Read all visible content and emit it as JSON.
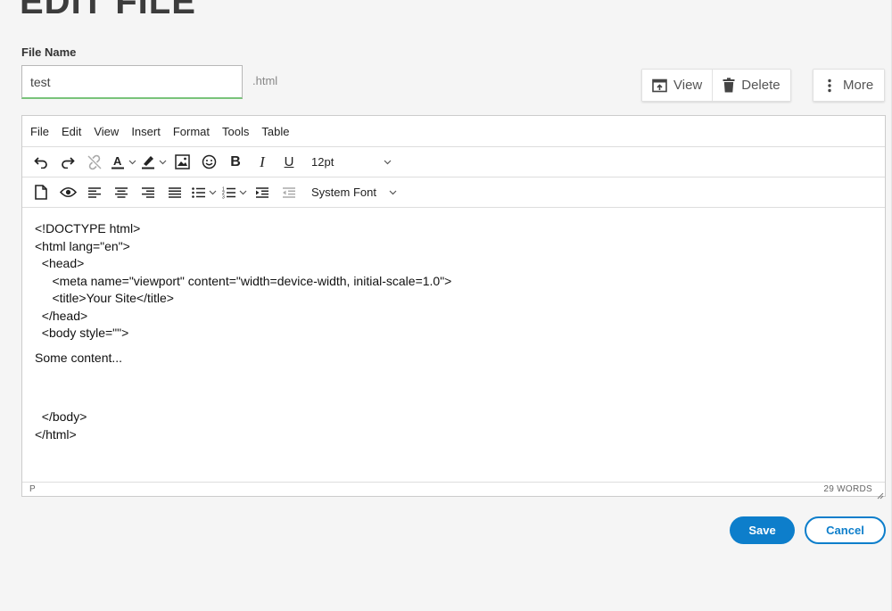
{
  "page": {
    "title": "EDIT FILE"
  },
  "file_name": {
    "label": "File Name",
    "value": "test",
    "extension": ".html"
  },
  "actions": {
    "view": "View",
    "delete": "Delete",
    "more": "More"
  },
  "editor": {
    "menu": [
      "File",
      "Edit",
      "View",
      "Insert",
      "Format",
      "Tools",
      "Table"
    ],
    "font_size": "12pt",
    "font_family": "System Font",
    "content_lines": [
      "<!DOCTYPE html>",
      "<html lang=\"en\">",
      "  <head>",
      "     <meta name=\"viewport\" content=\"width=device-width, initial-scale=1.0\">",
      "     <title>Your Site</title>",
      "  </head>",
      "  <body style=\"\">"
    ],
    "paragraph": "Some content...",
    "closing_lines": [
      "  </body>",
      "</html>"
    ],
    "status_path": "P",
    "word_count": "29 WORDS"
  },
  "buttons": {
    "save": "Save",
    "cancel": "Cancel"
  },
  "colors": {
    "primary": "#0d7ecb",
    "input_focus": "#79c37a"
  }
}
